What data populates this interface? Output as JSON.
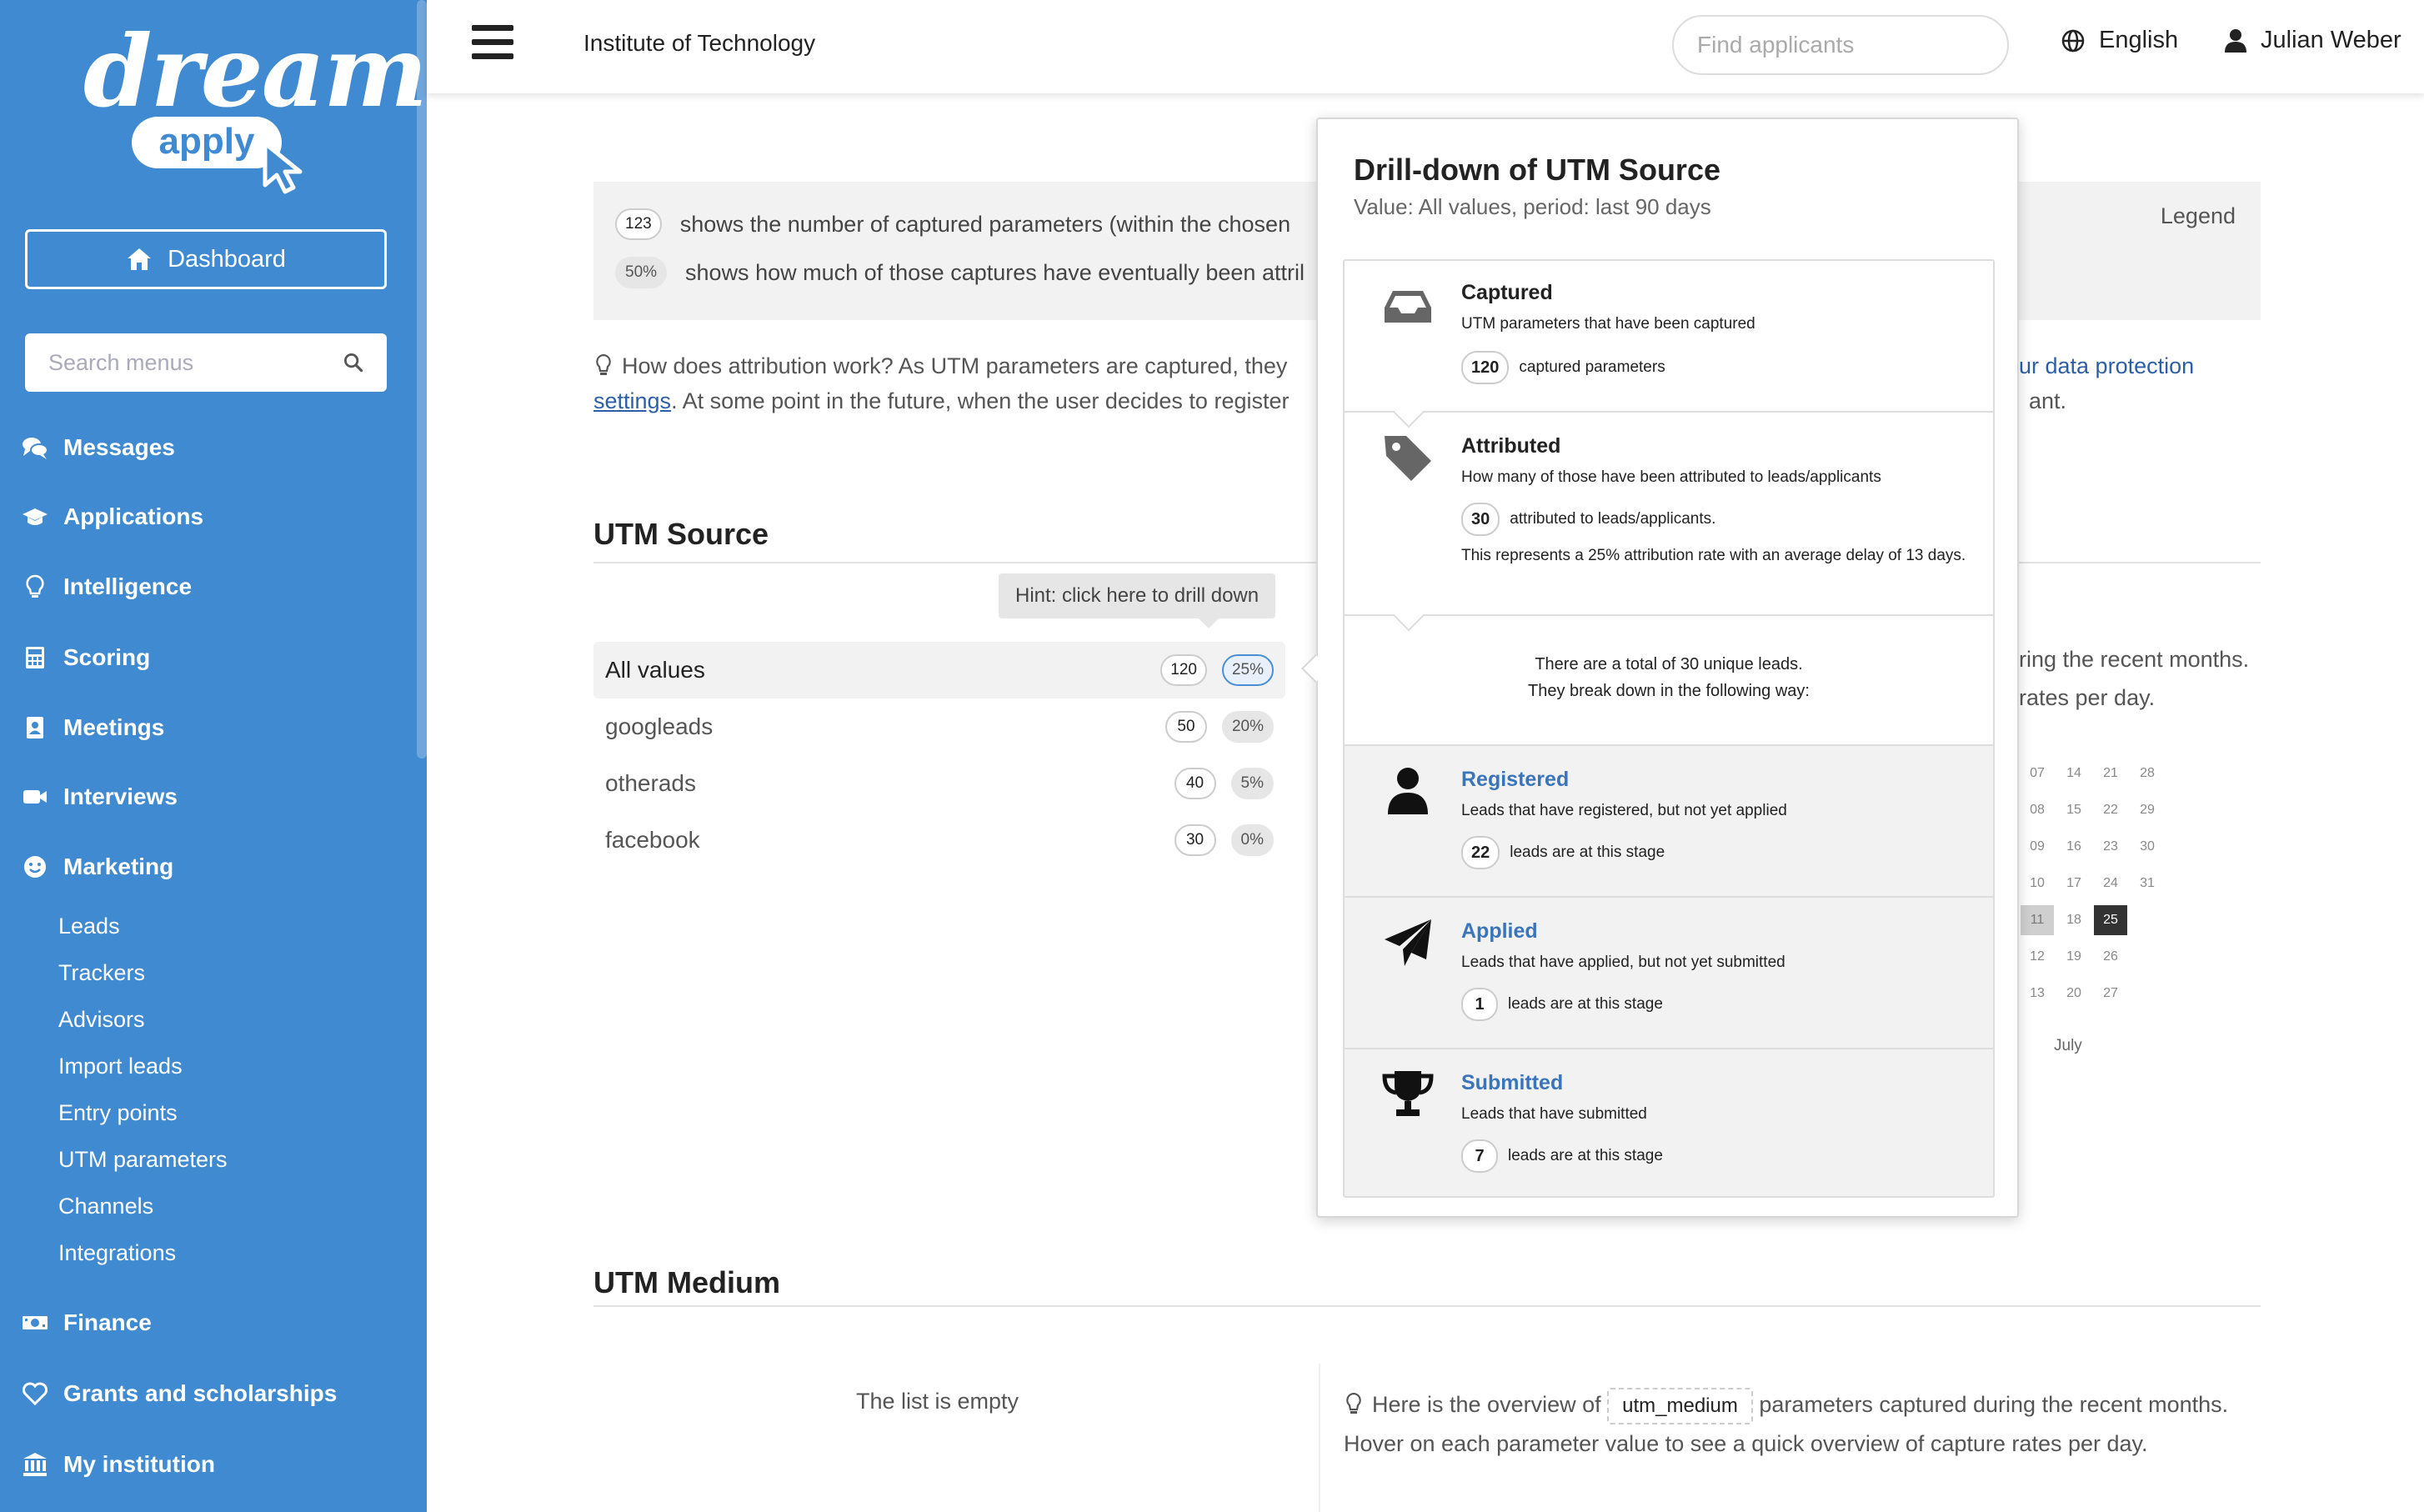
{
  "app": {
    "brand_word": "dream",
    "brand_pill": "apply",
    "institution": "Institute of Technology"
  },
  "header": {
    "search_placeholder": "Find applicants",
    "language": "English",
    "user_name": "Julian Weber"
  },
  "sidebar": {
    "dashboard_label": "Dashboard",
    "search_placeholder": "Search menus",
    "items": [
      {
        "label": "Messages",
        "icon": "comments-icon"
      },
      {
        "label": "Applications",
        "icon": "graduation-cap-icon"
      },
      {
        "label": "Intelligence",
        "icon": "lightbulb-icon"
      },
      {
        "label": "Scoring",
        "icon": "calculator-icon"
      },
      {
        "label": "Meetings",
        "icon": "address-book-icon"
      },
      {
        "label": "Interviews",
        "icon": "video-camera-icon"
      },
      {
        "label": "Marketing",
        "icon": "smile-icon"
      },
      {
        "label": "Finance",
        "icon": "money-icon"
      },
      {
        "label": "Grants and scholarships",
        "icon": "heart-icon"
      },
      {
        "label": "My institution",
        "icon": "institution-icon"
      }
    ],
    "marketing_subitems": [
      "Leads",
      "Trackers",
      "Advisors",
      "Import leads",
      "Entry points",
      "UTM parameters",
      "Channels",
      "Integrations"
    ]
  },
  "legend": {
    "label": "Legend",
    "count_badge": "123",
    "count_text": "shows the number of captured parameters (within the chosen",
    "pct_badge": "50%",
    "pct_text": "shows how much of those captures have eventually been attril"
  },
  "attribution": {
    "text_part1": "How does attribution work? As UTM parameters are captured, they",
    "text_link_a": "ur data protection",
    "text_link_b": "settings",
    "text_part2": ". At some point in the future, when the user decides to register",
    "text_part3": "ant."
  },
  "utm_source": {
    "title": "UTM Source",
    "hint": "Hint: click here to drill down",
    "rows": [
      {
        "label": "All values",
        "count": "120",
        "pct": "25%"
      },
      {
        "label": "googleads",
        "count": "50",
        "pct": "20%"
      },
      {
        "label": "otherads",
        "count": "40",
        "pct": "5%"
      },
      {
        "label": "facebook",
        "count": "30",
        "pct": "0%"
      }
    ],
    "right_line1": "ring the recent months.",
    "right_line2": "rates per day.",
    "calendar_month": "July",
    "calendar_rows": [
      [
        "07",
        "14",
        "21",
        "28"
      ],
      [
        "08",
        "15",
        "22",
        "29"
      ],
      [
        "09",
        "16",
        "23",
        "30"
      ],
      [
        "10",
        "17",
        "24",
        "31"
      ],
      [
        "11",
        "18",
        "25",
        ""
      ],
      [
        "12",
        "19",
        "26",
        ""
      ],
      [
        "13",
        "20",
        "27",
        ""
      ]
    ]
  },
  "utm_medium": {
    "title": "UTM Medium",
    "empty_text": "The list is empty",
    "overview_pre": "Here is the overview of",
    "param_code": "utm_medium",
    "overview_post": "parameters captured during the recent months.",
    "overview_line2": "Hover on each parameter value to see a quick overview of capture rates per day."
  },
  "drilldown": {
    "title": "Drill-down of UTM Source",
    "subtitle": "Value: All values, period: last 90 days",
    "captured": {
      "head": "Captured",
      "desc": "UTM parameters that have been captured",
      "count": "120",
      "count_text": "captured parameters"
    },
    "attributed": {
      "head": "Attributed",
      "desc": "How many of those have been attributed to leads/applicants",
      "count": "30",
      "count_text": "attributed to leads/applicants.",
      "rate_text": "This represents a 25% attribution rate with an average delay of 13 days."
    },
    "summary_line1": "There are a total of 30 unique leads.",
    "summary_line2": "They break down in the following way:",
    "registered": {
      "head": "Registered",
      "desc": "Leads that have registered, but not yet applied",
      "count": "22",
      "count_text": "leads are at this stage"
    },
    "applied": {
      "head": "Applied",
      "desc": "Leads that have applied, but not yet submitted",
      "count": "1",
      "count_text": "leads are at this stage"
    },
    "submitted": {
      "head": "Submitted",
      "desc": "Leads that have submitted",
      "count": "7",
      "count_text": "leads are at this stage"
    }
  },
  "colors": {
    "sidebar": "#3f8ad0",
    "link": "#2c5fa8",
    "stage_head": "#3a75bb"
  }
}
